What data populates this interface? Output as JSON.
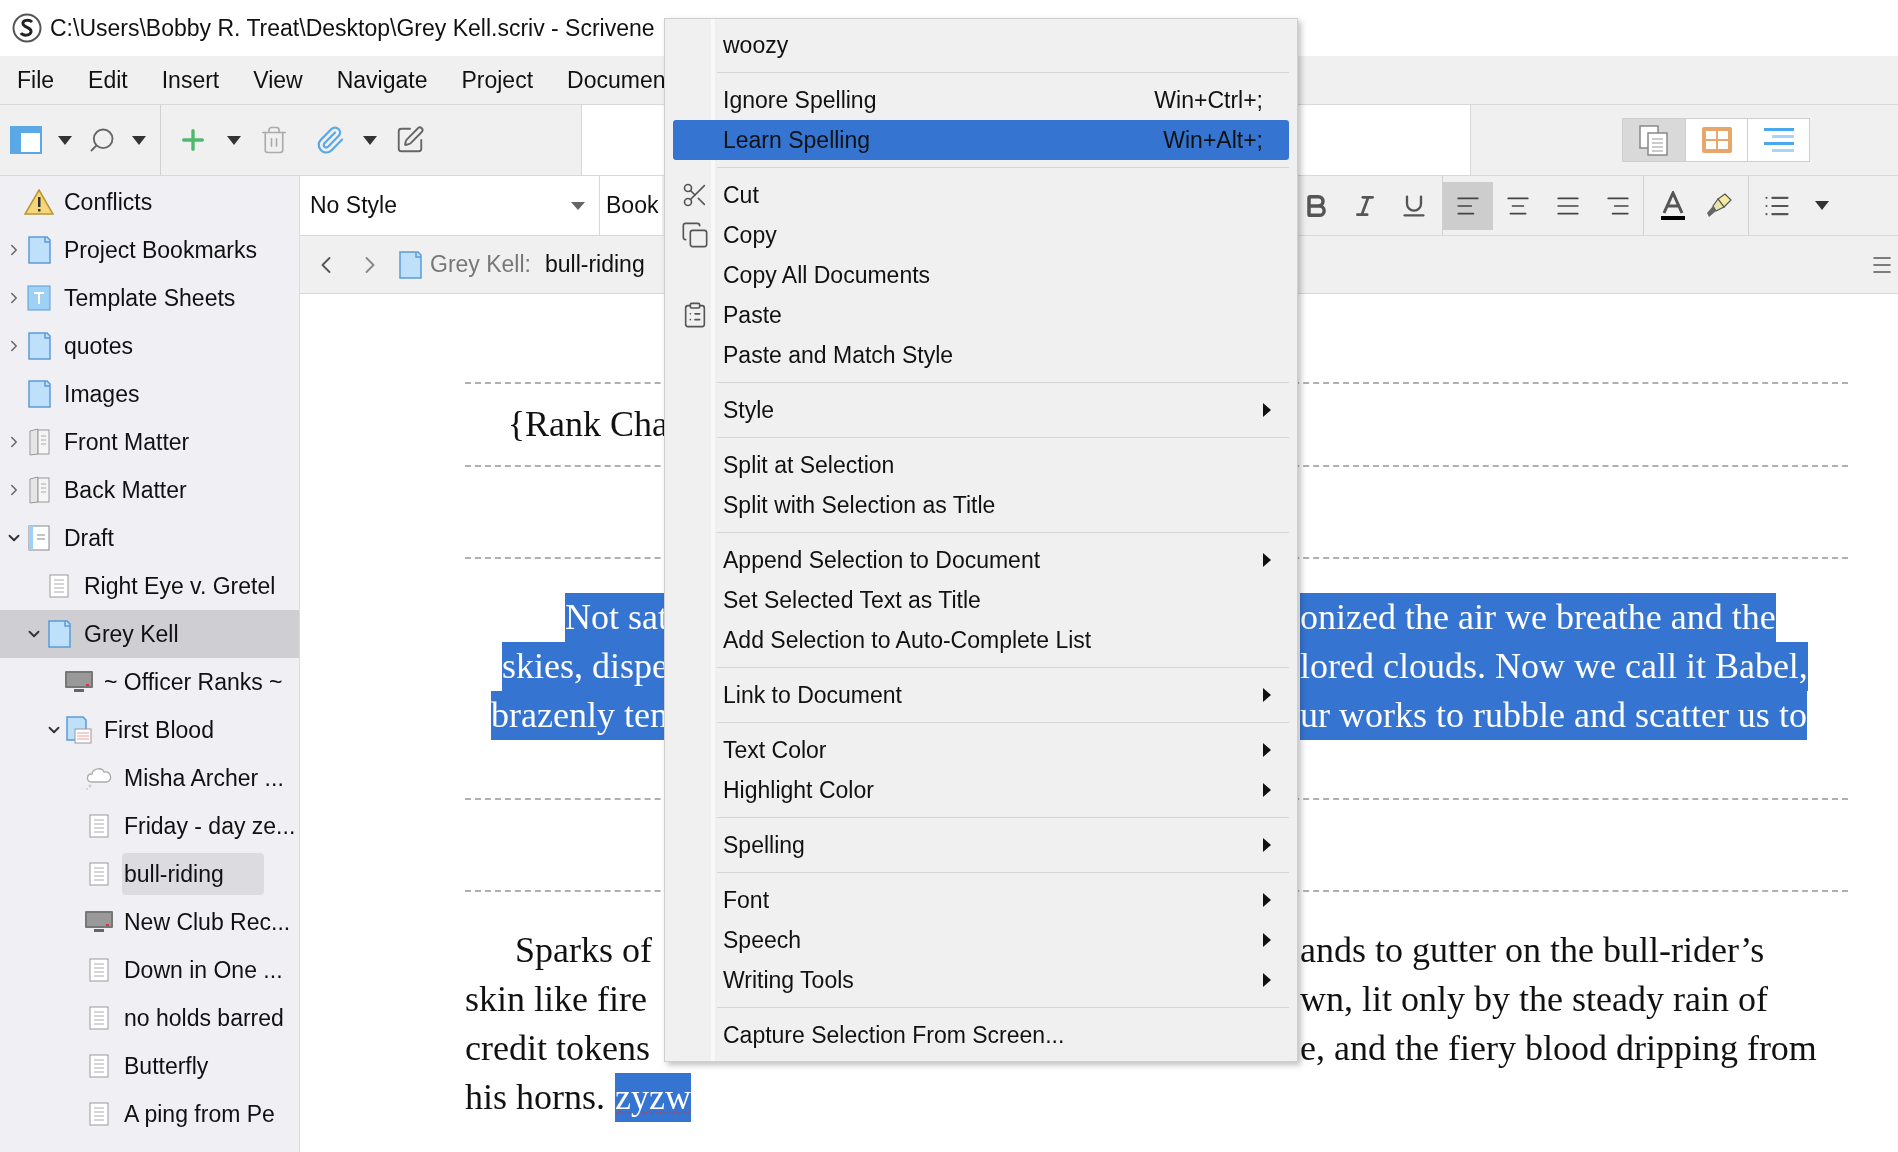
{
  "title_bar": {
    "title": "C:\\Users\\Bobby R. Treat\\Desktop\\Grey Kell.scriv - Scrivene"
  },
  "menu_bar": [
    "File",
    "Edit",
    "Insert",
    "View",
    "Navigate",
    "Project",
    "Documen"
  ],
  "binder": {
    "items": [
      {
        "label": "Conflicts",
        "kind": "warning",
        "selected": false,
        "in_editor": false
      },
      {
        "label": "Project Bookmarks",
        "kind": "folder",
        "expanded": false,
        "selected": false,
        "in_editor": false
      },
      {
        "label": "Template Sheets",
        "kind": "template",
        "expanded": false,
        "selected": false,
        "in_editor": false
      },
      {
        "label": "quotes",
        "kind": "folder",
        "expanded": false,
        "selected": false,
        "in_editor": false
      },
      {
        "label": "Images",
        "kind": "folder",
        "selected": false,
        "in_editor": false
      },
      {
        "label": "Front Matter",
        "kind": "matter",
        "expanded": false,
        "selected": false,
        "in_editor": false
      },
      {
        "label": "Back Matter",
        "kind": "matter",
        "expanded": false,
        "selected": false,
        "in_editor": false
      },
      {
        "label": "Draft",
        "kind": "draft",
        "expanded": true,
        "selected": false,
        "in_editor": false,
        "children": [
          {
            "label": "Right Eye v. Gretel",
            "kind": "text",
            "selected": false,
            "in_editor": false
          },
          {
            "label": "Grey Kell",
            "kind": "folder",
            "expanded": true,
            "selected": true,
            "in_editor": false,
            "children": [
              {
                "label": "~ Officer Ranks ~",
                "kind": "monitor",
                "selected": false,
                "in_editor": false
              },
              {
                "label": "First Blood",
                "kind": "chapter",
                "expanded": true,
                "selected": false,
                "in_editor": false,
                "children": [
                  {
                    "label": "Misha Archer ...",
                    "kind": "cloud",
                    "selected": false,
                    "in_editor": false
                  },
                  {
                    "label": "Friday - day ze...",
                    "kind": "text",
                    "selected": false,
                    "in_editor": false
                  },
                  {
                    "label": "bull-riding",
                    "kind": "text",
                    "selected": false,
                    "in_editor": true
                  },
                  {
                    "label": "New Club Rec...",
                    "kind": "monitor",
                    "selected": false,
                    "in_editor": false
                  },
                  {
                    "label": "Down in One ...",
                    "kind": "text",
                    "selected": false,
                    "in_editor": false
                  },
                  {
                    "label": "no holds barred",
                    "kind": "text",
                    "selected": false,
                    "in_editor": false
                  },
                  {
                    "label": "Butterfly",
                    "kind": "text",
                    "selected": false,
                    "in_editor": false
                  },
                  {
                    "label": "A ping from Pe",
                    "kind": "text",
                    "selected": false,
                    "in_editor": false
                  }
                ]
              }
            ]
          }
        ]
      }
    ]
  },
  "format_bar": {
    "style": "No Style",
    "font": "Book",
    "alignment": [
      {
        "kind": "left",
        "selected": true
      },
      {
        "kind": "center",
        "selected": false
      },
      {
        "kind": "justify",
        "selected": false
      },
      {
        "kind": "right",
        "selected": false
      }
    ]
  },
  "view_modes": [
    {
      "kind": "scrivenings",
      "selected": true
    },
    {
      "kind": "corkboard",
      "selected": false
    },
    {
      "kind": "outliner",
      "selected": false
    }
  ],
  "navigation": {
    "group": "Grey Kell:",
    "document": "bull-riding"
  },
  "editor": {
    "blocks": [
      {
        "kind": "title",
        "selected": false,
        "lines": [
          {
            "left": "{Rank Cha"
          }
        ]
      },
      {
        "kind": "centered",
        "selected": true,
        "lines": [
          {
            "left": "Not sat",
            "right": "onized the air we breathe and the"
          },
          {
            "left": "skies, dispe",
            "right": "lored clouds. Now we call it Babel,"
          },
          {
            "left": "brazenly ten",
            "right": "ur works to rubble and scatter us to"
          }
        ]
      },
      {
        "kind": "body",
        "selected": false,
        "lines": [
          {
            "left": "Sparks of",
            "right": "ands to gutter on the bull-rider’s"
          },
          {
            "left": "skin like fire",
            "right": "wn, lit only by the steady rain of"
          },
          {
            "left": "credit tokens",
            "right": "e, and the fiery blood dripping from"
          },
          {
            "left": "his horns.",
            "misspelled": "zyzw"
          }
        ]
      }
    ]
  },
  "context_menu": {
    "groups": [
      [
        {
          "label": "woozy",
          "selected": false
        }
      ],
      [
        {
          "label": "Ignore Spelling",
          "shortcut": "Win+Ctrl+;",
          "selected": false
        },
        {
          "label": "Learn Spelling",
          "shortcut": "Win+Alt+;",
          "selected": true
        }
      ],
      [
        {
          "label": "Cut",
          "kind": "cut",
          "selected": false
        },
        {
          "label": "Copy",
          "kind": "copy",
          "selected": false
        },
        {
          "label": "Copy All Documents",
          "selected": false
        },
        {
          "label": "Paste",
          "kind": "paste",
          "selected": false
        },
        {
          "label": "Paste and Match Style",
          "selected": false
        }
      ],
      [
        {
          "label": "Style",
          "submenu": true,
          "selected": false
        }
      ],
      [
        {
          "label": "Split at Selection",
          "selected": false
        },
        {
          "label": "Split with Selection as Title",
          "selected": false
        }
      ],
      [
        {
          "label": "Append Selection to Document",
          "submenu": true,
          "selected": false
        },
        {
          "label": "Set Selected Text as Title",
          "selected": false
        },
        {
          "label": "Add Selection to Auto-Complete List",
          "selected": false
        }
      ],
      [
        {
          "label": "Link to Document",
          "submenu": true,
          "selected": false
        }
      ],
      [
        {
          "label": "Text Color",
          "submenu": true,
          "selected": false
        },
        {
          "label": "Highlight Color",
          "submenu": true,
          "selected": false
        }
      ],
      [
        {
          "label": "Spelling",
          "submenu": true,
          "selected": false
        }
      ],
      [
        {
          "label": "Font",
          "submenu": true,
          "selected": false
        },
        {
          "label": "Speech",
          "submenu": true,
          "selected": false
        },
        {
          "label": "Writing Tools",
          "submenu": true,
          "selected": false
        }
      ],
      [
        {
          "label": "Capture Selection From Screen...",
          "selected": false
        }
      ]
    ]
  }
}
